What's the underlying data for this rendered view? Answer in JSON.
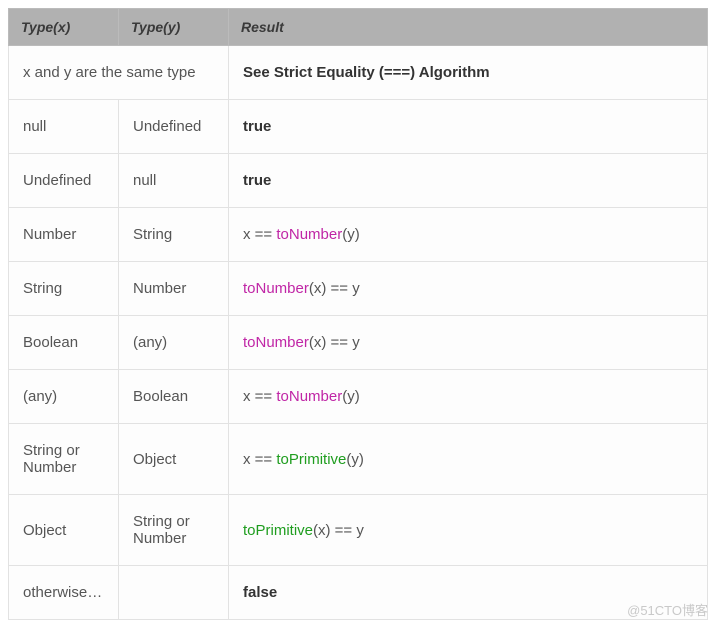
{
  "headers": {
    "x": "Type(x)",
    "y": "Type(y)",
    "result": "Result"
  },
  "rows": [
    {
      "span2": "x and y are the same type",
      "result": [
        {
          "t": "See Strict Equality (===) Algorithm",
          "c": "bold"
        }
      ]
    },
    {
      "x": "null",
      "y": "Undefined",
      "result": [
        {
          "t": "true",
          "c": "bold"
        }
      ]
    },
    {
      "x": "Undefined",
      "y": "null",
      "result": [
        {
          "t": "true",
          "c": "bold"
        }
      ]
    },
    {
      "x": "Number",
      "y": "String",
      "result": [
        {
          "t": "x == "
        },
        {
          "t": "toNumber",
          "c": "fn-num"
        },
        {
          "t": "(y)"
        }
      ]
    },
    {
      "x": "String",
      "y": "Number",
      "result": [
        {
          "t": "toNumber",
          "c": "fn-num"
        },
        {
          "t": "(x) == y"
        }
      ]
    },
    {
      "x": "Boolean",
      "y": "(any)",
      "result": [
        {
          "t": "toNumber",
          "c": "fn-num"
        },
        {
          "t": "(x) == y"
        }
      ]
    },
    {
      "x": "(any)",
      "y": "Boolean",
      "result": [
        {
          "t": "x == "
        },
        {
          "t": "toNumber",
          "c": "fn-num"
        },
        {
          "t": "(y)"
        }
      ]
    },
    {
      "x": "String or Number",
      "y": "Object",
      "result": [
        {
          "t": "x == "
        },
        {
          "t": "toPrimitive",
          "c": "fn-prim"
        },
        {
          "t": "(y)"
        }
      ]
    },
    {
      "x": "Object",
      "y": "String or Number",
      "result": [
        {
          "t": "toPrimitive",
          "c": "fn-prim"
        },
        {
          "t": "(x) == y"
        }
      ]
    },
    {
      "x": "otherwise…",
      "y": "",
      "result": [
        {
          "t": "false",
          "c": "bold"
        }
      ]
    }
  ],
  "watermark": "@51CTO博客"
}
